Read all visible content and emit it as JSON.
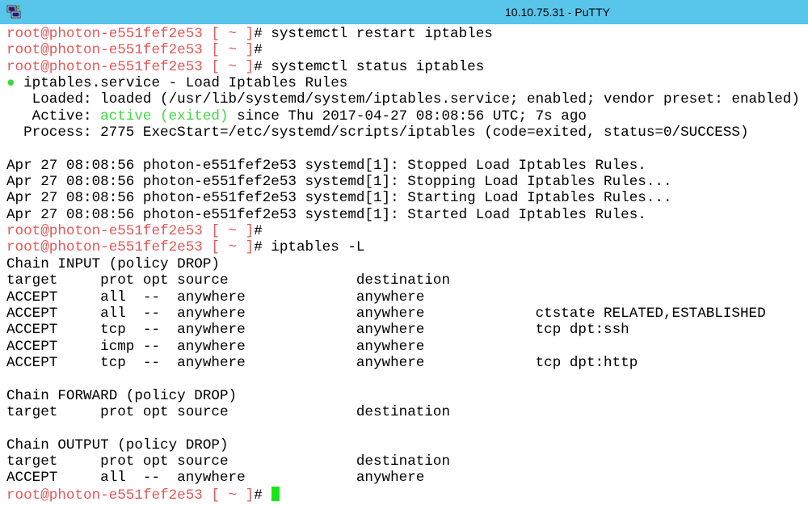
{
  "window": {
    "title": "10.10.75.31 - PuTTY"
  },
  "colors": {
    "titlebar": "#58c6eb",
    "prompt": "#e35757",
    "active": "#3fd93f",
    "bullet": "#3fd93f",
    "text": "#000000",
    "cursor": "#19e619",
    "background": "#ffffff"
  },
  "icons": {
    "app": "putty-icon"
  },
  "terminal": {
    "lines": [
      [
        {
          "t": "root@photon-e551fef2e53 [ ~ ]",
          "c": "prompt"
        },
        {
          "t": "# systemctl restart iptables"
        }
      ],
      [
        {
          "t": "root@photon-e551fef2e53 [ ~ ]",
          "c": "prompt"
        },
        {
          "t": "#"
        }
      ],
      [
        {
          "t": "root@photon-e551fef2e53 [ ~ ]",
          "c": "prompt"
        },
        {
          "t": "# systemctl status iptables"
        }
      ],
      [
        {
          "t": "●",
          "c": "bullet"
        },
        {
          "t": " iptables.service - Load Iptables Rules"
        }
      ],
      [
        {
          "t": "   Loaded: loaded (/usr/lib/systemd/system/iptables.service; enabled; vendor preset: enabled)"
        }
      ],
      [
        {
          "t": "   Active: "
        },
        {
          "t": "active (exited)",
          "c": "active"
        },
        {
          "t": " since Thu 2017-04-27 08:08:56 UTC; 7s ago"
        }
      ],
      [
        {
          "t": "  Process: 2775 ExecStart=/etc/systemd/scripts/iptables (code=exited, status=0/SUCCESS)"
        }
      ],
      [],
      [
        {
          "t": "Apr 27 08:08:56 photon-e551fef2e53 systemd[1]: Stopped Load Iptables Rules."
        }
      ],
      [
        {
          "t": "Apr 27 08:08:56 photon-e551fef2e53 systemd[1]: Stopping Load Iptables Rules..."
        }
      ],
      [
        {
          "t": "Apr 27 08:08:56 photon-e551fef2e53 systemd[1]: Starting Load Iptables Rules..."
        }
      ],
      [
        {
          "t": "Apr 27 08:08:56 photon-e551fef2e53 systemd[1]: Started Load Iptables Rules."
        }
      ],
      [
        {
          "t": "root@photon-e551fef2e53 [ ~ ]",
          "c": "prompt"
        },
        {
          "t": "#"
        }
      ],
      [
        {
          "t": "root@photon-e551fef2e53 [ ~ ]",
          "c": "prompt"
        },
        {
          "t": "# iptables -L"
        }
      ],
      [
        {
          "t": "Chain INPUT (policy DROP)"
        }
      ],
      [
        {
          "t": "target     prot opt source               destination"
        }
      ],
      [
        {
          "t": "ACCEPT     all  --  anywhere             anywhere"
        }
      ],
      [
        {
          "t": "ACCEPT     all  --  anywhere             anywhere             ctstate RELATED,ESTABLISHED"
        }
      ],
      [
        {
          "t": "ACCEPT     tcp  --  anywhere             anywhere             tcp dpt:ssh"
        }
      ],
      [
        {
          "t": "ACCEPT     icmp --  anywhere             anywhere"
        }
      ],
      [
        {
          "t": "ACCEPT     tcp  --  anywhere             anywhere             tcp dpt:http"
        }
      ],
      [],
      [
        {
          "t": "Chain FORWARD (policy DROP)"
        }
      ],
      [
        {
          "t": "target     prot opt source               destination"
        }
      ],
      [],
      [
        {
          "t": "Chain OUTPUT (policy DROP)"
        }
      ],
      [
        {
          "t": "target     prot opt source               destination"
        }
      ],
      [
        {
          "t": "ACCEPT     all  --  anywhere             anywhere"
        }
      ],
      [
        {
          "t": "root@photon-e551fef2e53 [ ~ ]",
          "c": "prompt"
        },
        {
          "t": "# "
        },
        {
          "cursor": true
        }
      ]
    ]
  }
}
